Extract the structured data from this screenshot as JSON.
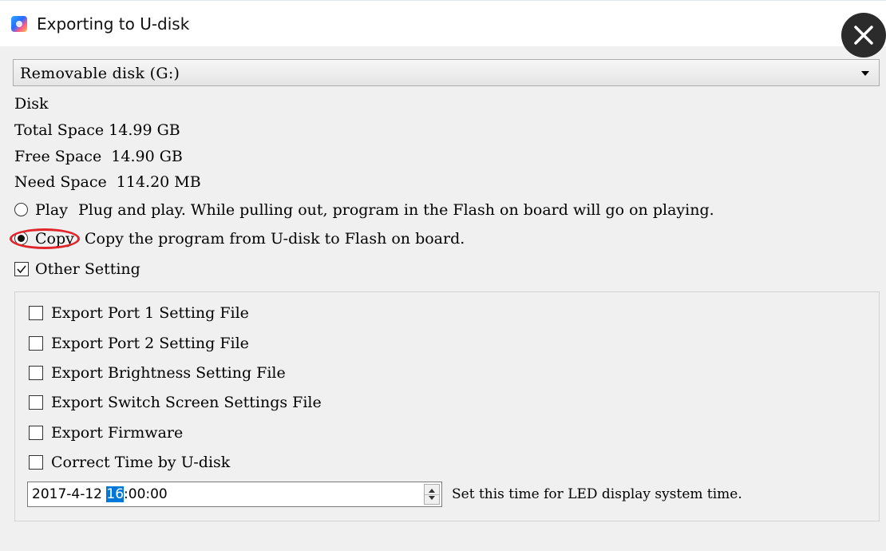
{
  "window": {
    "title": "Exporting to U-disk",
    "close_icon": "close-icon"
  },
  "drive": {
    "selected": "Removable disk (G:)"
  },
  "disk_info": {
    "heading": "Disk",
    "total_space": "Total Space 14.99 GB",
    "free_space": "Free Space  14.90 GB",
    "need_space": "Need Space  114.20 MB"
  },
  "mode": {
    "options": [
      {
        "label": "Play",
        "desc": "Plug and play. While pulling out, program in the Flash on board will go on playing.",
        "checked": false
      },
      {
        "label": "Copy",
        "desc": "Copy the program from U-disk to Flash on board.",
        "checked": true
      }
    ]
  },
  "other_setting": {
    "label": "Other Setting",
    "checked": true
  },
  "settings": {
    "items": [
      {
        "label": "Export Port 1 Setting File",
        "checked": false
      },
      {
        "label": "Export Port 2 Setting File",
        "checked": false
      },
      {
        "label": "Export Brightness Setting File",
        "checked": false
      },
      {
        "label": "Export Switch Screen Settings File",
        "checked": false
      },
      {
        "label": "Export Firmware",
        "checked": false
      },
      {
        "label": "Correct Time by U-disk",
        "checked": false
      }
    ]
  },
  "time": {
    "date": "2017-4-12 ",
    "hour": "16",
    "rest": ":00:00",
    "hint": "Set this time for LED display system time."
  },
  "colors": {
    "highlight": "#e0262b",
    "selection": "#0078d7",
    "close_button": "#2b2b2b"
  }
}
